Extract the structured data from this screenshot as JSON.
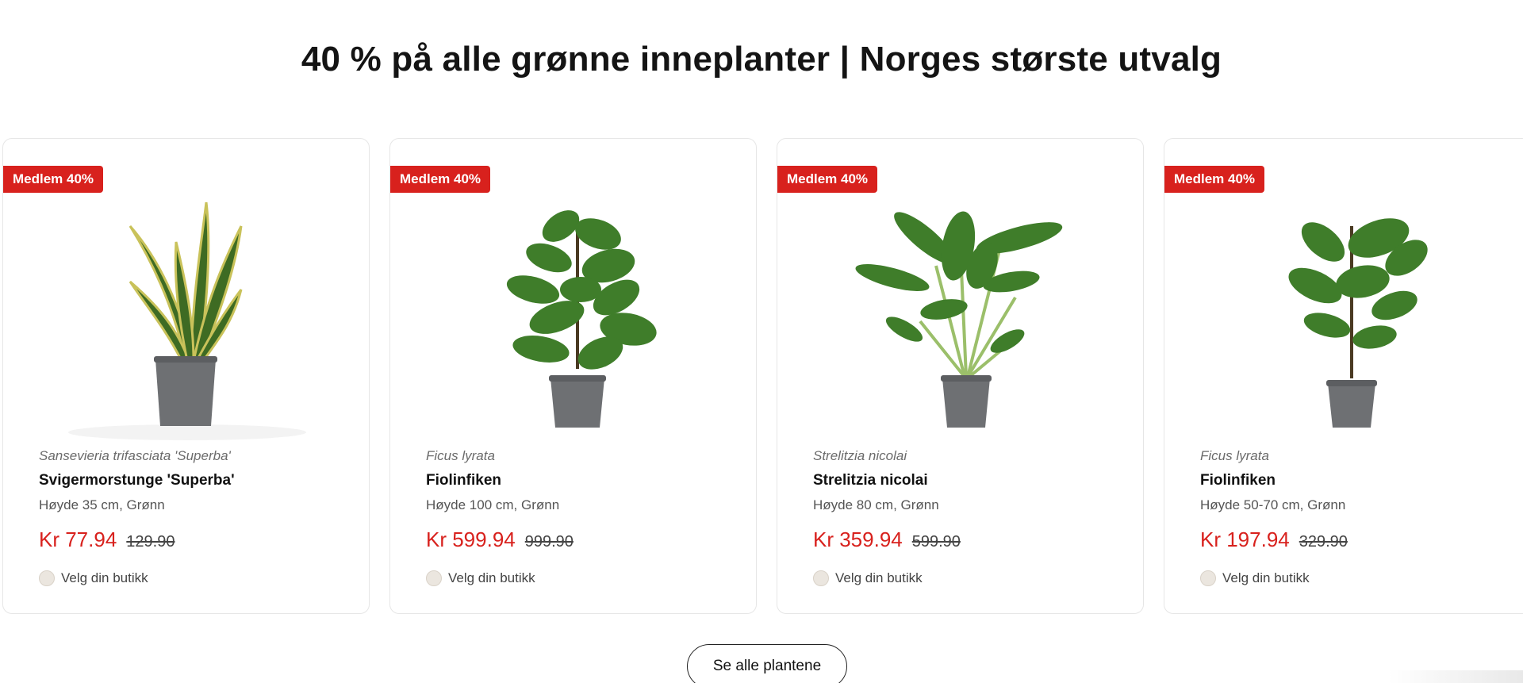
{
  "section": {
    "title": "40 % på alle grønne inneplanter | Norges største utvalg"
  },
  "products": [
    {
      "badge": "Medlem 40%",
      "latin": "Sansevieria trifasciata 'Superba'",
      "name": "Svigermorstunge 'Superba'",
      "spec": "Høyde 35 cm, Grønn",
      "price": "Kr 77.94",
      "old_price": "129.90",
      "store_label": "Velg din butikk",
      "image_icon": "snake-plant-image"
    },
    {
      "badge": "Medlem 40%",
      "latin": "Ficus lyrata",
      "name": "Fiolinfiken",
      "spec": "Høyde 100 cm, Grønn",
      "price": "Kr 599.94",
      "old_price": "999.90",
      "store_label": "Velg din butikk",
      "image_icon": "fiddle-leaf-fig-image"
    },
    {
      "badge": "Medlem 40%",
      "latin": "Strelitzia nicolai",
      "name": "Strelitzia nicolai",
      "spec": "Høyde 80 cm, Grønn",
      "price": "Kr 359.94",
      "old_price": "599.90",
      "store_label": "Velg din butikk",
      "image_icon": "bird-of-paradise-image"
    },
    {
      "badge": "Medlem 40%",
      "latin": "Ficus lyrata",
      "name": "Fiolinfiken",
      "spec": "Høyde 50-70 cm, Grønn",
      "price": "Kr 197.94",
      "old_price": "329.90",
      "store_label": "Velg din butikk",
      "image_icon": "fiddle-leaf-fig-small-image"
    }
  ],
  "see_all_label": "Se alle plantene",
  "colors": {
    "accent_red": "#d8211d",
    "pot_gray": "#6e7073",
    "leaf_green": "#3f7d2a"
  }
}
